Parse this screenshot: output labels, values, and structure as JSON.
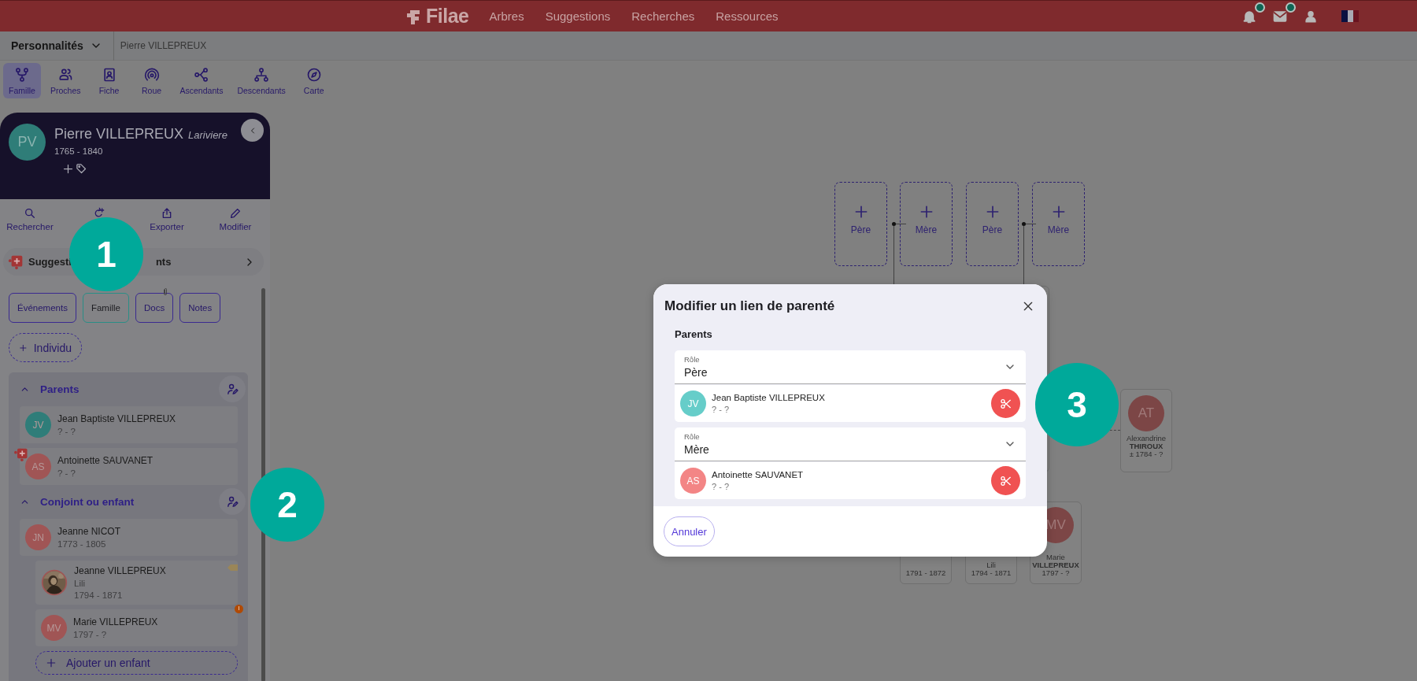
{
  "top_bar": {
    "logo": "Filae",
    "nav": [
      {
        "label": "Arbres"
      },
      {
        "label": "Suggestions"
      },
      {
        "label": "Recherches"
      },
      {
        "label": "Ressources"
      }
    ],
    "icons": [
      {
        "kind": "bell",
        "badge": true
      },
      {
        "kind": "mail",
        "badge": true
      },
      {
        "kind": "user"
      },
      {
        "kind": "flag"
      }
    ]
  },
  "breadcrumb": {
    "dropdown": "Personnalités",
    "current": "Pierre VILLEPREUX"
  },
  "view_tabs": [
    {
      "label": "Famille",
      "kind": "family",
      "selected": true
    },
    {
      "label": "Proches",
      "kind": "people",
      "selected": false
    },
    {
      "label": "Fiche",
      "kind": "card",
      "selected": false
    },
    {
      "label": "Roue",
      "kind": "wheel",
      "selected": false
    },
    {
      "label": "Ascendants",
      "kind": "ascend",
      "selected": false
    },
    {
      "label": "Descendants",
      "kind": "descend",
      "selected": false
    },
    {
      "label": "Carte",
      "kind": "compass",
      "selected": false
    }
  ],
  "person_header": {
    "initials": "PV",
    "name": "Pierre VILLEPREUX",
    "alias": "Lariviere",
    "dates": "1765 - 1840"
  },
  "actions": [
    {
      "label": "Rechercher",
      "kind": "search"
    },
    {
      "kind": "addperson"
    },
    {
      "label": "Exporter",
      "kind": "share"
    },
    {
      "label": "Modifier",
      "kind": "pencil"
    }
  ],
  "suggestions_bar": {
    "labels": [
      "Suggesti",
      "nts"
    ]
  },
  "section_tabs": [
    {
      "label": "Événements",
      "selected": false,
      "attachment": false
    },
    {
      "label": "Famille",
      "selected": true,
      "attachment": false
    },
    {
      "label": "Docs",
      "selected": false,
      "attachment": true
    },
    {
      "label": "Notes",
      "selected": false,
      "attachment": false
    }
  ],
  "add_individual": "Individu",
  "groups": [
    {
      "title": "Parents",
      "expanded": true,
      "members": [
        {
          "kind": "initials",
          "initials": "JV",
          "color": "#2f7d79",
          "name": "Jean Baptiste VILLEPREUX",
          "dates": "? - ?"
        },
        {
          "kind": "initials",
          "initials": "AS",
          "color": "#a05555",
          "name": "Antoinette SAUVANET",
          "dates": "? - ?",
          "suggestion": true
        }
      ]
    },
    {
      "title": "Conjoint ou enfant",
      "expanded": true,
      "members": [
        {
          "kind": "initials",
          "initials": "JN",
          "color": "#a05555",
          "name": "Jeanne NICOT",
          "dates": "1773 - 1805",
          "children": [
            {
              "kind": "picture",
              "name": "Jeanne VILLEPREUX",
              "nickname": "Lili",
              "dates": "1794 - 1871",
              "tag": true
            },
            {
              "kind": "initials",
              "initials": "MV",
              "color": "#a05555",
              "name": "Marie VILLEPREUX",
              "dates": "1797 - ?",
              "alert": true
            }
          ]
        }
      ]
    }
  ],
  "add_child": "Ajouter un enfant",
  "tree": {
    "placeholders": [
      {
        "label": "Père"
      },
      {
        "label": "Mère"
      },
      {
        "label": "Père"
      },
      {
        "label": "Mère"
      }
    ],
    "side_card": {
      "initials": "AT",
      "first_name": "Alexandrine",
      "last_name": "THIROUX",
      "dates": "± 1784 - ?"
    },
    "bottom_cards": [
      {
        "lines": [
          "1791 - 1872"
        ]
      },
      {
        "lines": [
          "Lili",
          "1794 - 1871"
        ]
      },
      {
        "initials": "MV",
        "lines": [
          "Marie",
          "VILLEPREUX",
          "1797 - ?"
        ]
      }
    ]
  },
  "modal": {
    "title": "Modifier un lien de parenté",
    "section": "Parents",
    "links": [
      {
        "role_label": "Rôle",
        "role": "Père",
        "initials": "JV",
        "color": "#66cdc9",
        "name": "Jean Baptiste VILLEPREUX",
        "dates": "? - ?"
      },
      {
        "role_label": "Rôle",
        "role": "Mère",
        "initials": "AS",
        "color": "#f38585",
        "name": "Antoinette SAUVANET",
        "dates": "? - ?"
      }
    ],
    "cancel": "Annuler"
  },
  "callouts": [
    {
      "number": "1"
    },
    {
      "number": "2"
    },
    {
      "number": "3"
    }
  ]
}
